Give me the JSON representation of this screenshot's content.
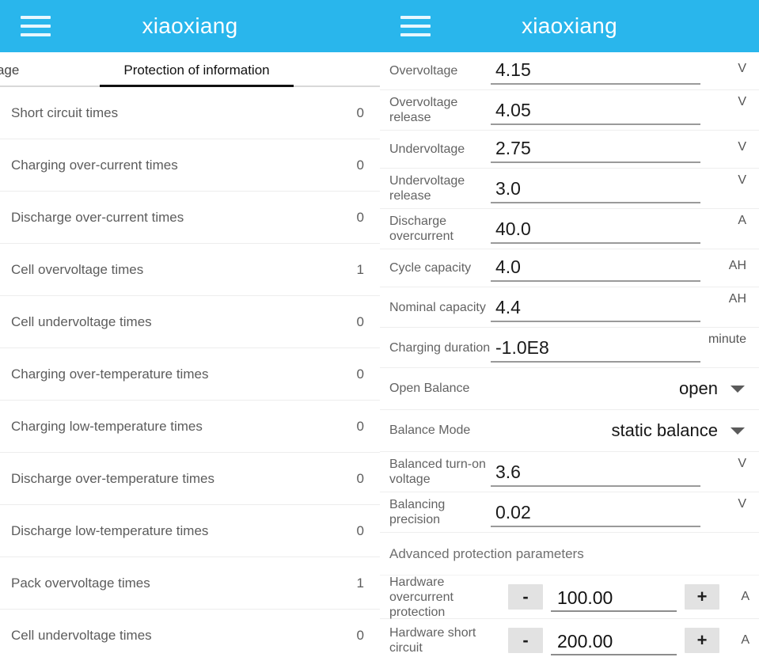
{
  "app": {
    "title": "xiaoxiang",
    "header_color": "#29b6ec",
    "menu_icon": "hamburger-menu-icon"
  },
  "left_panel": {
    "tabs": [
      {
        "label": "oltage",
        "active": false
      },
      {
        "label": "Protection of information",
        "active": true
      }
    ],
    "rows": [
      {
        "label": "Short circuit times",
        "value": "0"
      },
      {
        "label": "Charging over-current times",
        "value": "0"
      },
      {
        "label": "Discharge over-current times",
        "value": "0"
      },
      {
        "label": "Cell overvoltage times",
        "value": "1"
      },
      {
        "label": "Cell undervoltage times",
        "value": "0"
      },
      {
        "label": "Charging over-temperature times",
        "value": "0"
      },
      {
        "label": "Charging low-temperature times",
        "value": "0"
      },
      {
        "label": "Discharge over-temperature times",
        "value": "0"
      },
      {
        "label": "Discharge low-temperature times",
        "value": "0"
      },
      {
        "label": "Pack overvoltage times",
        "value": "1"
      },
      {
        "label": "Cell undervoltage times",
        "value": "0"
      }
    ]
  },
  "right_panel": {
    "fields": [
      {
        "label": "Overvoltage",
        "value": "4.15",
        "unit": "V",
        "lines": 1
      },
      {
        "label": "Overvoltage release",
        "value": "4.05",
        "unit": "V",
        "lines": 2
      },
      {
        "label": "Undervoltage",
        "value": "2.75",
        "unit": "V",
        "lines": 1
      },
      {
        "label": "Undervoltage release",
        "value": "3.0",
        "unit": "V",
        "lines": 2
      },
      {
        "label": "Discharge overcurrent",
        "value": "40.0",
        "unit": "A",
        "lines": 2
      },
      {
        "label": "Cycle capacity",
        "value": "4.0",
        "unit": "AH",
        "lines": 1
      },
      {
        "label": "Nominal capacity",
        "value": "4.4",
        "unit": "AH",
        "lines": 2
      },
      {
        "label": "Charging duration",
        "value": "-1.0E8",
        "unit": "minute",
        "lines": 2
      }
    ],
    "selects": [
      {
        "label": "Open Balance",
        "value": "open",
        "icon": "chevron-down-icon"
      },
      {
        "label": "Balance Mode",
        "value": "static balance",
        "icon": "chevron-down-icon"
      }
    ],
    "fields2": [
      {
        "label": "Balanced turn-on voltage",
        "value": "3.6",
        "unit": "V",
        "lines": 2
      },
      {
        "label": "Balancing precision",
        "value": "0.02",
        "unit": "V",
        "lines": 2
      }
    ],
    "advanced": {
      "section_title": "Advanced protection parameters",
      "minus_label": "-",
      "plus_label": "+",
      "rows": [
        {
          "label": "Hardware overcurrent protection",
          "value": "100.00",
          "unit": "A"
        },
        {
          "label": "Hardware short circuit",
          "value": "200.00",
          "unit": "A"
        }
      ]
    }
  }
}
